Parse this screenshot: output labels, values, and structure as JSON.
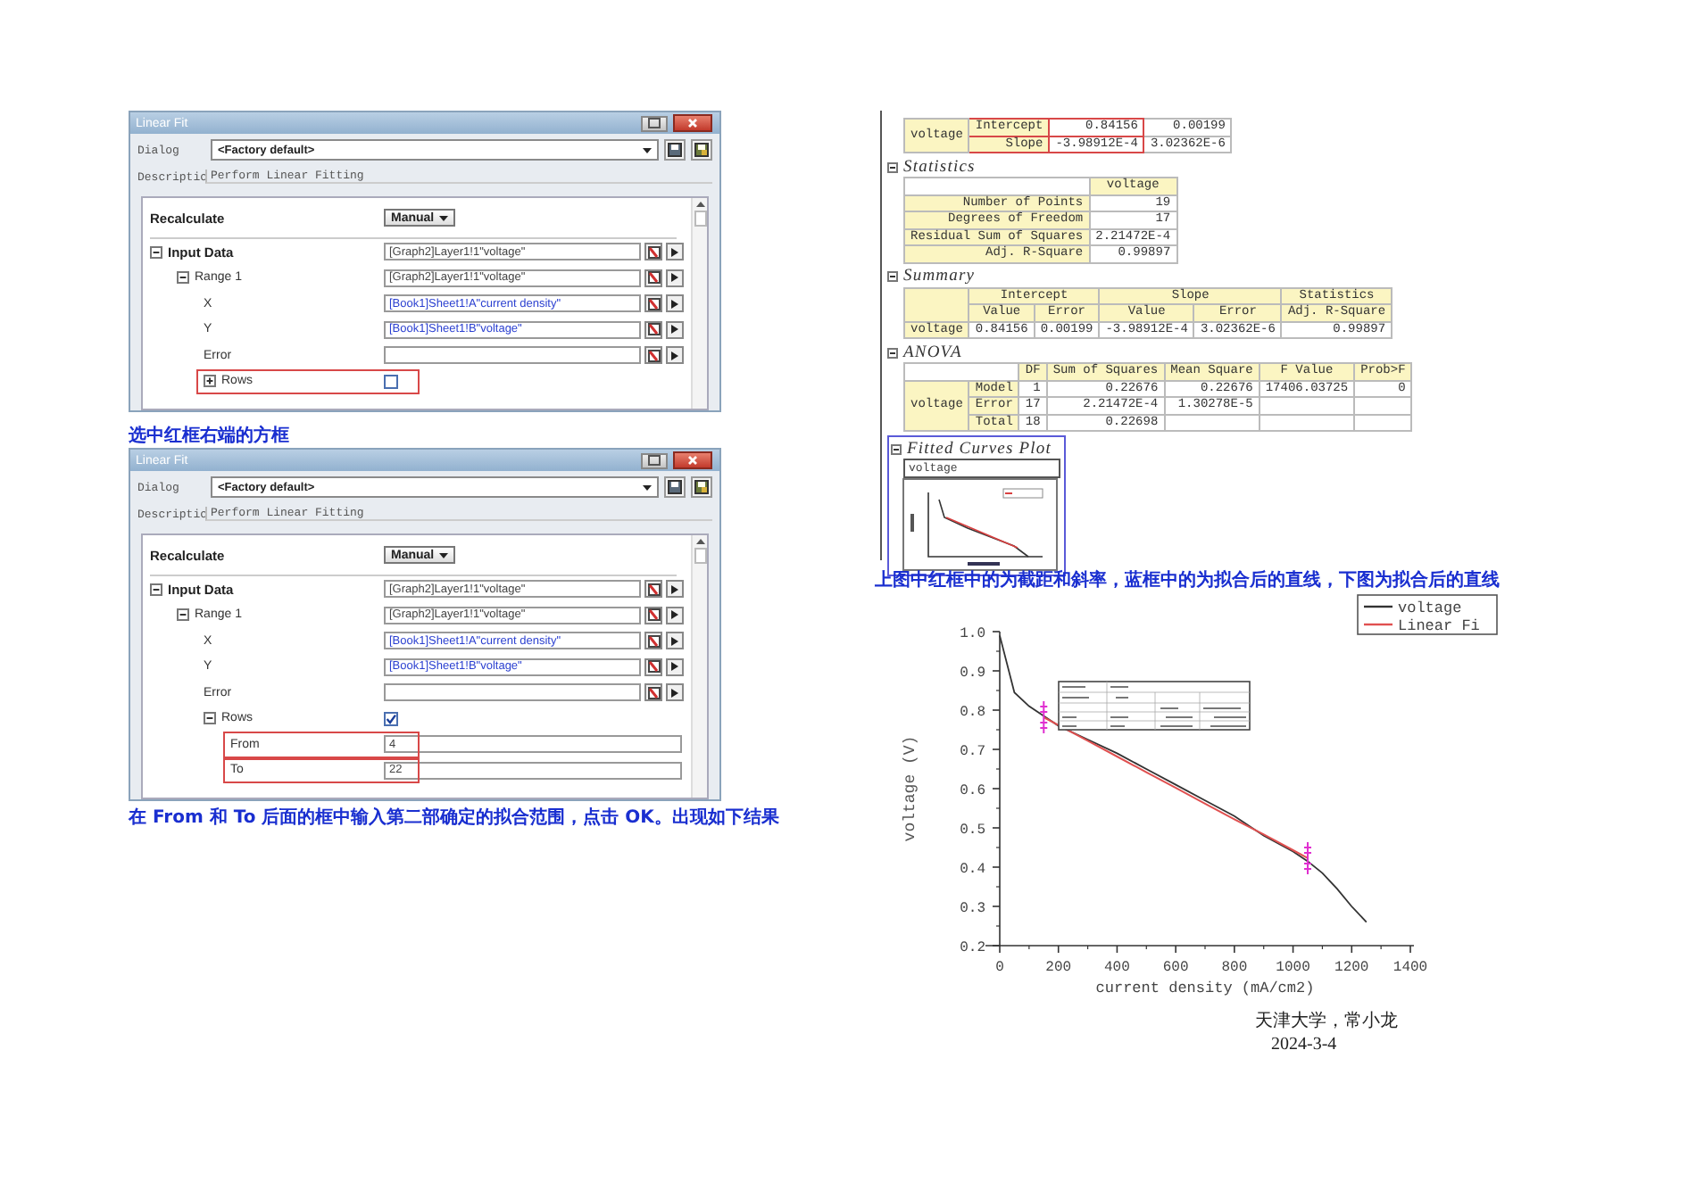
{
  "dialogs": [
    {
      "title": "Linear Fit",
      "dialog_label": "Dialog",
      "preset": "<Factory default>",
      "description_label": "Descriptic",
      "description": "Perform Linear Fitting",
      "recalculate_label": "Recalculate",
      "recalculate_value": "Manual",
      "tree": [
        {
          "kind": "group",
          "label": "Input Data",
          "expanded": true,
          "highlighted": false,
          "value": "[Graph2]Layer1!1\"voltage\"",
          "children": [
            {
              "kind": "group",
              "label": "Range 1",
              "expanded": true,
              "highlighted": false,
              "value": "[Graph2]Layer1!1\"voltage\"",
              "children": [
                {
                  "kind": "column",
                  "label": "X",
                  "highlighted": false,
                  "value": "[Book1]Sheet1!A\"current density\""
                },
                {
                  "kind": "column",
                  "label": "Y",
                  "highlighted": false,
                  "value": "[Book1]Sheet1!B\"voltage\""
                },
                {
                  "kind": "range",
                  "label": "Error",
                  "highlighted": false
                },
                {
                  "kind": "check",
                  "label": "Rows",
                  "expanded": false,
                  "checked": false,
                  "highlighted": true
                }
              ]
            }
          ]
        }
      ]
    },
    {
      "title": "Linear Fit",
      "dialog_label": "Dialog",
      "preset": "<Factory default>",
      "description_label": "Descriptic",
      "description": "Perform Linear Fitting",
      "recalculate_label": "Recalculate",
      "recalculate_value": "Manual",
      "tree": [
        {
          "kind": "group",
          "label": "Input Data",
          "expanded": true,
          "highlighted": false,
          "value": "[Graph2]Layer1!1\"voltage\"",
          "children": [
            {
              "kind": "group",
              "label": "Range 1",
              "expanded": true,
              "highlighted": false,
              "value": "[Graph2]Layer1!1\"voltage\"",
              "children": [
                {
                  "kind": "column",
                  "label": "X",
                  "highlighted": false,
                  "value": "[Book1]Sheet1!A\"current density\""
                },
                {
                  "kind": "column",
                  "label": "Y",
                  "highlighted": false,
                  "value": "[Book1]Sheet1!B\"voltage\""
                },
                {
                  "kind": "range",
                  "label": "Error",
                  "highlighted": false
                },
                {
                  "kind": "check",
                  "label": "Rows",
                  "expanded": true,
                  "checked": true,
                  "highlighted": false,
                  "children": [
                    {
                      "kind": "number",
                      "label": "From",
                      "value": "4",
                      "highlighted": true
                    },
                    {
                      "kind": "number",
                      "label": "To",
                      "value": "22",
                      "highlighted": true
                    }
                  ]
                }
              ]
            }
          ]
        }
      ]
    }
  ],
  "captions": [
    "选中红框右端的方框",
    "在 From 和 To 后面的框中输入第二部确定的拟合范围，点击 OK。出现如下结果"
  ],
  "report": {
    "sections": [
      {
        "kind": "table",
        "table": {
          "row_groups": [
            {
              "label": "voltage",
              "rows": [
                {
                  "label": "Intercept",
                  "cells": [
                    "0.84156",
                    "0.00199"
                  ],
                  "highlighted": true
                },
                {
                  "label": "Slope",
                  "cells": [
                    "-3.98912E-4",
                    "3.02362E-6"
                  ],
                  "highlighted": true
                }
              ]
            }
          ]
        }
      },
      {
        "kind": "table",
        "title": "Statistics",
        "table": {
          "columns": [
            "voltage"
          ],
          "rows": [
            {
              "label": "Number of Points",
              "cells": [
                "19"
              ],
              "highlighted": false
            },
            {
              "label": "Degrees of Freedom",
              "cells": [
                "17"
              ],
              "highlighted": false
            },
            {
              "label": "Residual Sum of Squares",
              "cells": [
                "2.21472E-4"
              ],
              "highlighted": false
            },
            {
              "label": "Adj. R-Square",
              "cells": [
                "0.99897"
              ],
              "highlighted": false
            }
          ]
        }
      },
      {
        "kind": "table",
        "title": "Summary",
        "table": {
          "column_groups": [
            {
              "label": "Intercept",
              "columns": [
                "Value",
                "Error"
              ]
            },
            {
              "label": "Slope",
              "columns": [
                "Value",
                "Error"
              ]
            },
            {
              "label": "Statistics",
              "columns": [
                "Adj. R-Square"
              ]
            }
          ],
          "rows": [
            {
              "label": "voltage",
              "cells": [
                "0.84156",
                "0.00199",
                "-3.98912E-4",
                "3.02362E-6",
                "0.99897"
              ],
              "highlighted": false
            }
          ]
        }
      },
      {
        "kind": "table",
        "title": "ANOVA",
        "table": {
          "columns": [
            "DF",
            "Sum of Squares",
            "Mean Square",
            "F Value",
            "Prob>F"
          ],
          "row_groups": [
            {
              "label": "voltage",
              "rows": [
                {
                  "label": "Model",
                  "cells": [
                    "1",
                    "0.22676",
                    "0.22676",
                    "17406.03725",
                    "0"
                  ],
                  "highlighted": false
                },
                {
                  "label": "Error",
                  "cells": [
                    "17",
                    "2.21472E-4",
                    "1.30278E-5"
                  ],
                  "highlighted": false
                },
                {
                  "label": "Total",
                  "cells": [
                    "18",
                    "0.22698"
                  ],
                  "highlighted": false
                }
              ]
            }
          ]
        }
      },
      {
        "kind": "plot",
        "title": "Fitted Curves Plot",
        "plot_label": "voltage",
        "highlighted": true
      }
    ]
  },
  "result_caption": "上图中红框中的为截距和斜率，蓝框中的为拟合后的直线，下图为拟合后的直线",
  "chart": {
    "chart_data": {
      "type": "line",
      "xlabel": "current density (mA/cm2)",
      "ylabel": "voltage (V)",
      "x": [
        0,
        50,
        100,
        150,
        200,
        300,
        400,
        500,
        600,
        700,
        800,
        900,
        1000,
        1050,
        1100,
        1150,
        1200,
        1250
      ],
      "series": [
        {
          "name": "voltage",
          "color": "#333333",
          "values": [
            0.99,
            0.845,
            0.81,
            0.785,
            0.76,
            0.725,
            0.69,
            0.65,
            0.61,
            0.57,
            0.53,
            0.48,
            0.44,
            0.415,
            0.385,
            0.345,
            0.3,
            0.26
          ]
        },
        {
          "name": "Linear Fi",
          "color": "#e05050",
          "values": [
            null,
            null,
            null,
            0.782,
            0.762,
            0.722,
            0.682,
            0.642,
            0.602,
            0.562,
            0.522,
            0.483,
            0.443,
            0.423,
            null,
            null,
            null,
            null
          ]
        }
      ],
      "xlim": [
        0,
        1400
      ],
      "ylim": [
        0.2,
        1.0
      ],
      "legend": "upper right",
      "xticks": [
        0,
        200,
        400,
        600,
        800,
        1000,
        1200,
        1400
      ],
      "yticks": [
        {
          "value": 0.2,
          "label": "0.2"
        },
        {
          "value": 0.3,
          "label": "0.3"
        },
        {
          "value": 0.4,
          "label": "0.4"
        },
        {
          "value": 0.5,
          "label": "0.5"
        },
        {
          "value": 0.6,
          "label": "0.6"
        },
        {
          "value": 0.7,
          "label": "0.7"
        },
        {
          "value": 0.8,
          "label": "0.8"
        },
        {
          "value": 0.9,
          "label": "0.9"
        },
        {
          "value": 1.0,
          "label": "1.0"
        }
      ]
    }
  },
  "signature": [
    "天津大学，常小龙",
    "2024-3-4"
  ]
}
